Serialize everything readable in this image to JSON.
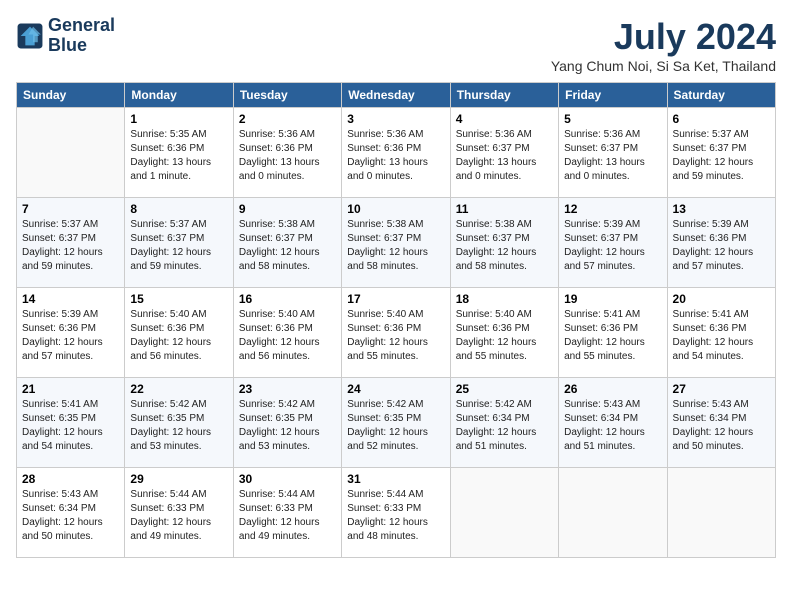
{
  "header": {
    "logo_line1": "General",
    "logo_line2": "Blue",
    "month_title": "July 2024",
    "location": "Yang Chum Noi, Si Sa Ket, Thailand"
  },
  "days_of_week": [
    "Sunday",
    "Monday",
    "Tuesday",
    "Wednesday",
    "Thursday",
    "Friday",
    "Saturday"
  ],
  "weeks": [
    [
      {
        "num": "",
        "sunrise": "",
        "sunset": "",
        "daylight": ""
      },
      {
        "num": "1",
        "sunrise": "5:35 AM",
        "sunset": "6:36 PM",
        "daylight": "13 hours and 1 minute."
      },
      {
        "num": "2",
        "sunrise": "5:36 AM",
        "sunset": "6:36 PM",
        "daylight": "13 hours and 0 minutes."
      },
      {
        "num": "3",
        "sunrise": "5:36 AM",
        "sunset": "6:36 PM",
        "daylight": "13 hours and 0 minutes."
      },
      {
        "num": "4",
        "sunrise": "5:36 AM",
        "sunset": "6:37 PM",
        "daylight": "13 hours and 0 minutes."
      },
      {
        "num": "5",
        "sunrise": "5:36 AM",
        "sunset": "6:37 PM",
        "daylight": "13 hours and 0 minutes."
      },
      {
        "num": "6",
        "sunrise": "5:37 AM",
        "sunset": "6:37 PM",
        "daylight": "12 hours and 59 minutes."
      }
    ],
    [
      {
        "num": "7",
        "sunrise": "5:37 AM",
        "sunset": "6:37 PM",
        "daylight": "12 hours and 59 minutes."
      },
      {
        "num": "8",
        "sunrise": "5:37 AM",
        "sunset": "6:37 PM",
        "daylight": "12 hours and 59 minutes."
      },
      {
        "num": "9",
        "sunrise": "5:38 AM",
        "sunset": "6:37 PM",
        "daylight": "12 hours and 58 minutes."
      },
      {
        "num": "10",
        "sunrise": "5:38 AM",
        "sunset": "6:37 PM",
        "daylight": "12 hours and 58 minutes."
      },
      {
        "num": "11",
        "sunrise": "5:38 AM",
        "sunset": "6:37 PM",
        "daylight": "12 hours and 58 minutes."
      },
      {
        "num": "12",
        "sunrise": "5:39 AM",
        "sunset": "6:37 PM",
        "daylight": "12 hours and 57 minutes."
      },
      {
        "num": "13",
        "sunrise": "5:39 AM",
        "sunset": "6:36 PM",
        "daylight": "12 hours and 57 minutes."
      }
    ],
    [
      {
        "num": "14",
        "sunrise": "5:39 AM",
        "sunset": "6:36 PM",
        "daylight": "12 hours and 57 minutes."
      },
      {
        "num": "15",
        "sunrise": "5:40 AM",
        "sunset": "6:36 PM",
        "daylight": "12 hours and 56 minutes."
      },
      {
        "num": "16",
        "sunrise": "5:40 AM",
        "sunset": "6:36 PM",
        "daylight": "12 hours and 56 minutes."
      },
      {
        "num": "17",
        "sunrise": "5:40 AM",
        "sunset": "6:36 PM",
        "daylight": "12 hours and 55 minutes."
      },
      {
        "num": "18",
        "sunrise": "5:40 AM",
        "sunset": "6:36 PM",
        "daylight": "12 hours and 55 minutes."
      },
      {
        "num": "19",
        "sunrise": "5:41 AM",
        "sunset": "6:36 PM",
        "daylight": "12 hours and 55 minutes."
      },
      {
        "num": "20",
        "sunrise": "5:41 AM",
        "sunset": "6:36 PM",
        "daylight": "12 hours and 54 minutes."
      }
    ],
    [
      {
        "num": "21",
        "sunrise": "5:41 AM",
        "sunset": "6:35 PM",
        "daylight": "12 hours and 54 minutes."
      },
      {
        "num": "22",
        "sunrise": "5:42 AM",
        "sunset": "6:35 PM",
        "daylight": "12 hours and 53 minutes."
      },
      {
        "num": "23",
        "sunrise": "5:42 AM",
        "sunset": "6:35 PM",
        "daylight": "12 hours and 53 minutes."
      },
      {
        "num": "24",
        "sunrise": "5:42 AM",
        "sunset": "6:35 PM",
        "daylight": "12 hours and 52 minutes."
      },
      {
        "num": "25",
        "sunrise": "5:42 AM",
        "sunset": "6:34 PM",
        "daylight": "12 hours and 51 minutes."
      },
      {
        "num": "26",
        "sunrise": "5:43 AM",
        "sunset": "6:34 PM",
        "daylight": "12 hours and 51 minutes."
      },
      {
        "num": "27",
        "sunrise": "5:43 AM",
        "sunset": "6:34 PM",
        "daylight": "12 hours and 50 minutes."
      }
    ],
    [
      {
        "num": "28",
        "sunrise": "5:43 AM",
        "sunset": "6:34 PM",
        "daylight": "12 hours and 50 minutes."
      },
      {
        "num": "29",
        "sunrise": "5:44 AM",
        "sunset": "6:33 PM",
        "daylight": "12 hours and 49 minutes."
      },
      {
        "num": "30",
        "sunrise": "5:44 AM",
        "sunset": "6:33 PM",
        "daylight": "12 hours and 49 minutes."
      },
      {
        "num": "31",
        "sunrise": "5:44 AM",
        "sunset": "6:33 PM",
        "daylight": "12 hours and 48 minutes."
      },
      {
        "num": "",
        "sunrise": "",
        "sunset": "",
        "daylight": ""
      },
      {
        "num": "",
        "sunrise": "",
        "sunset": "",
        "daylight": ""
      },
      {
        "num": "",
        "sunrise": "",
        "sunset": "",
        "daylight": ""
      }
    ]
  ]
}
